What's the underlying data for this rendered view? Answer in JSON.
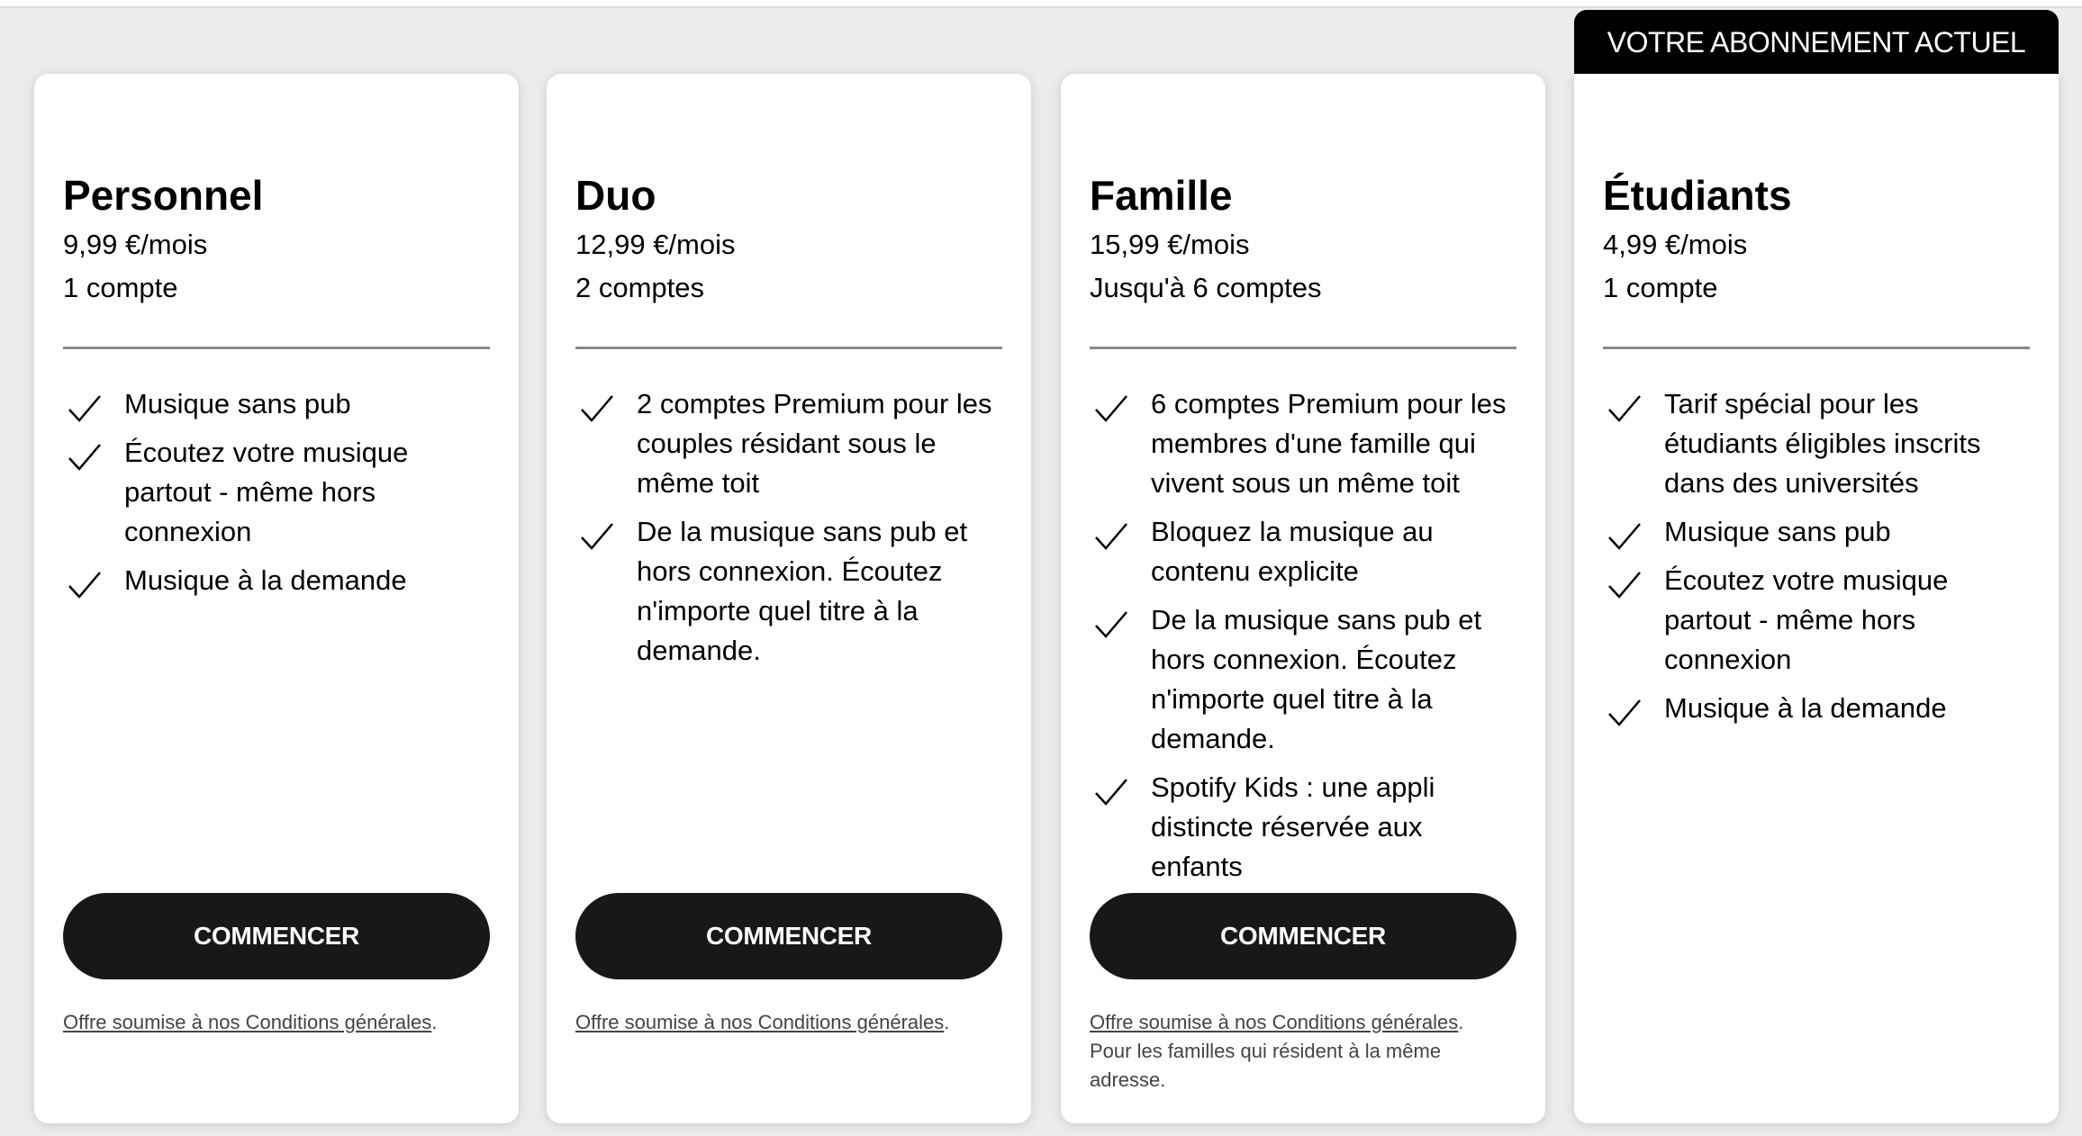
{
  "current_plan_banner": "VOTRE ABONNEMENT ACTUEL",
  "plans": [
    {
      "name": "Personnel",
      "price": "9,99 €/mois",
      "accounts": "1 compte",
      "features": [
        "Musique sans pub",
        "Écoutez votre musique partout - même hors connexion",
        "Musique à la demande"
      ],
      "button": "COMMENCER",
      "terms_link": "Offre soumise à nos Conditions générales",
      "terms_suffix": ".",
      "note": ""
    },
    {
      "name": "Duo",
      "price": "12,99 €/mois",
      "accounts": "2 comptes",
      "features": [
        "2 comptes Premium pour les couples résidant sous le même toit",
        "De la musique sans pub et hors connexion. Écoutez n'importe quel titre à la demande."
      ],
      "button": "COMMENCER",
      "terms_link": "Offre soumise à nos Conditions générales",
      "terms_suffix": ".",
      "note": ""
    },
    {
      "name": "Famille",
      "price": "15,99 €/mois",
      "accounts": "Jusqu'à 6 comptes",
      "features": [
        "6 comptes Premium pour les membres d'une famille qui vivent sous un même toit",
        "Bloquez la musique au contenu explicite",
        "De la musique sans pub et hors connexion. Écoutez n'importe quel titre à la demande.",
        "Spotify Kids : une appli distincte réservée aux enfants"
      ],
      "button": "COMMENCER",
      "terms_link": "Offre soumise à nos Conditions générales",
      "terms_suffix": ".",
      "note": "Pour les familles qui résident à la même adresse."
    },
    {
      "name": "Étudiants",
      "price": "4,99 €/mois",
      "accounts": "1 compte",
      "features": [
        "Tarif spécial pour les étudiants éligibles inscrits dans des universités",
        "Musique sans pub",
        "Écoutez votre musique partout - même hors connexion",
        "Musique à la demande"
      ]
    }
  ]
}
